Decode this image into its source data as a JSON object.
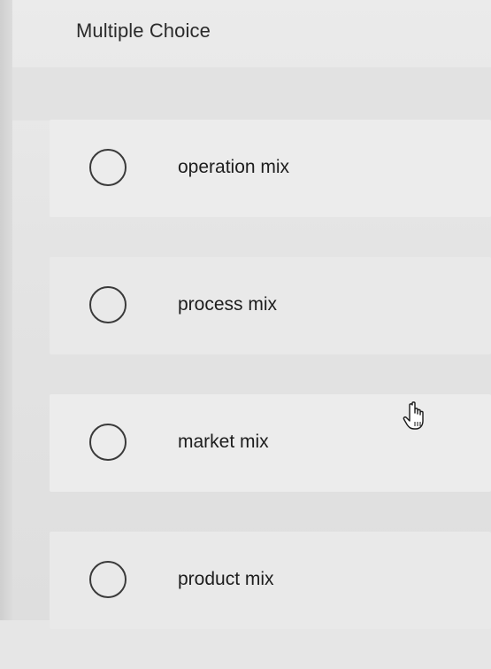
{
  "question": {
    "title": "Multiple Choice"
  },
  "options": [
    {
      "label": "operation mix"
    },
    {
      "label": "process mix"
    },
    {
      "label": "market mix"
    },
    {
      "label": "product mix"
    }
  ],
  "cursor": {
    "icon": "hand-pointer-icon"
  },
  "colors": {
    "background": "#e6e6e6",
    "option_background": "#ebebeb",
    "radio_border": "#3a3a3a",
    "text": "#1f1f1f"
  }
}
